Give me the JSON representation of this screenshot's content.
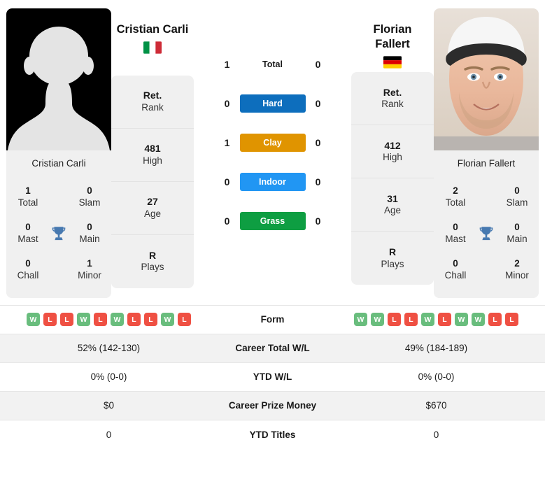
{
  "players": {
    "left": {
      "name": "Cristian Carli",
      "name_lines": [
        "Cristian Carli"
      ],
      "photo_caption": "Cristian Carli",
      "flag": "italy-flag",
      "flag_colors": [
        "#009246",
        "#ffffff",
        "#ce2b37"
      ],
      "photo_type": "placeholder-silhouette",
      "rank": [
        {
          "value": "Ret.",
          "label": "Rank"
        },
        {
          "value": "481",
          "label": "High"
        },
        {
          "value": "27",
          "label": "Age"
        },
        {
          "value": "R",
          "label": "Plays"
        }
      ],
      "titles": {
        "total": "1",
        "total_label": "Total",
        "slam": "0",
        "slam_label": "Slam",
        "mast": "0",
        "mast_label": "Mast",
        "main": "0",
        "main_label": "Main",
        "chall": "0",
        "chall_label": "Chall",
        "minor": "1",
        "minor_label": "Minor"
      },
      "form": [
        "W",
        "L",
        "L",
        "W",
        "L",
        "W",
        "L",
        "L",
        "W",
        "L"
      ],
      "career_total_wl": "52% (142-130)",
      "ytd_wl": "0% (0-0)",
      "career_prize_money": "$0",
      "ytd_titles": "0"
    },
    "right": {
      "name": "Florian Fallert",
      "name_lines": [
        "Florian",
        "Fallert"
      ],
      "photo_caption": "Florian Fallert",
      "flag": "germany-flag",
      "flag_colors": [
        "#000000",
        "#dd0000",
        "#ffce00"
      ],
      "photo_type": "player-portrait",
      "rank": [
        {
          "value": "Ret.",
          "label": "Rank"
        },
        {
          "value": "412",
          "label": "High"
        },
        {
          "value": "31",
          "label": "Age"
        },
        {
          "value": "R",
          "label": "Plays"
        }
      ],
      "titles": {
        "total": "2",
        "total_label": "Total",
        "slam": "0",
        "slam_label": "Slam",
        "mast": "0",
        "mast_label": "Mast",
        "main": "0",
        "main_label": "Main",
        "chall": "0",
        "chall_label": "Chall",
        "minor": "2",
        "minor_label": "Minor"
      },
      "form": [
        "W",
        "W",
        "L",
        "L",
        "W",
        "L",
        "W",
        "W",
        "L",
        "L"
      ],
      "career_total_wl": "49% (184-189)",
      "ytd_wl": "0% (0-0)",
      "career_prize_money": "$670",
      "ytd_titles": "0"
    }
  },
  "h2h": [
    {
      "surface": "Total",
      "left": "1",
      "right": "0",
      "color": "",
      "pill": false
    },
    {
      "surface": "Hard",
      "left": "0",
      "right": "0",
      "color": "#0d6ebd",
      "pill": true
    },
    {
      "surface": "Clay",
      "left": "1",
      "right": "0",
      "color": "#e09400",
      "pill": true
    },
    {
      "surface": "Indoor",
      "left": "0",
      "right": "0",
      "color": "#2196f3",
      "pill": true
    },
    {
      "surface": "Grass",
      "left": "0",
      "right": "0",
      "color": "#0e9e42",
      "pill": true
    }
  ],
  "table": {
    "rows": [
      {
        "label": "Form",
        "left": "",
        "right": "",
        "type": "form",
        "alt": false
      },
      {
        "label": "Career Total W/L",
        "left": "52% (142-130)",
        "right": "49% (184-189)",
        "type": "text",
        "alt": true
      },
      {
        "label": "YTD W/L",
        "left": "0% (0-0)",
        "right": "0% (0-0)",
        "type": "text",
        "alt": false
      },
      {
        "label": "Career Prize Money",
        "left": "$0",
        "right": "$670",
        "type": "text",
        "alt": true
      },
      {
        "label": "YTD Titles",
        "left": "0",
        "right": "0",
        "type": "text",
        "alt": false
      }
    ]
  },
  "colors": {
    "card_bg": "#f0f0f0",
    "row_alt_bg": "#f2f2f2",
    "win_badge": "#69bd7d",
    "loss_badge": "#ef5043",
    "trophy": "#4779b0"
  }
}
